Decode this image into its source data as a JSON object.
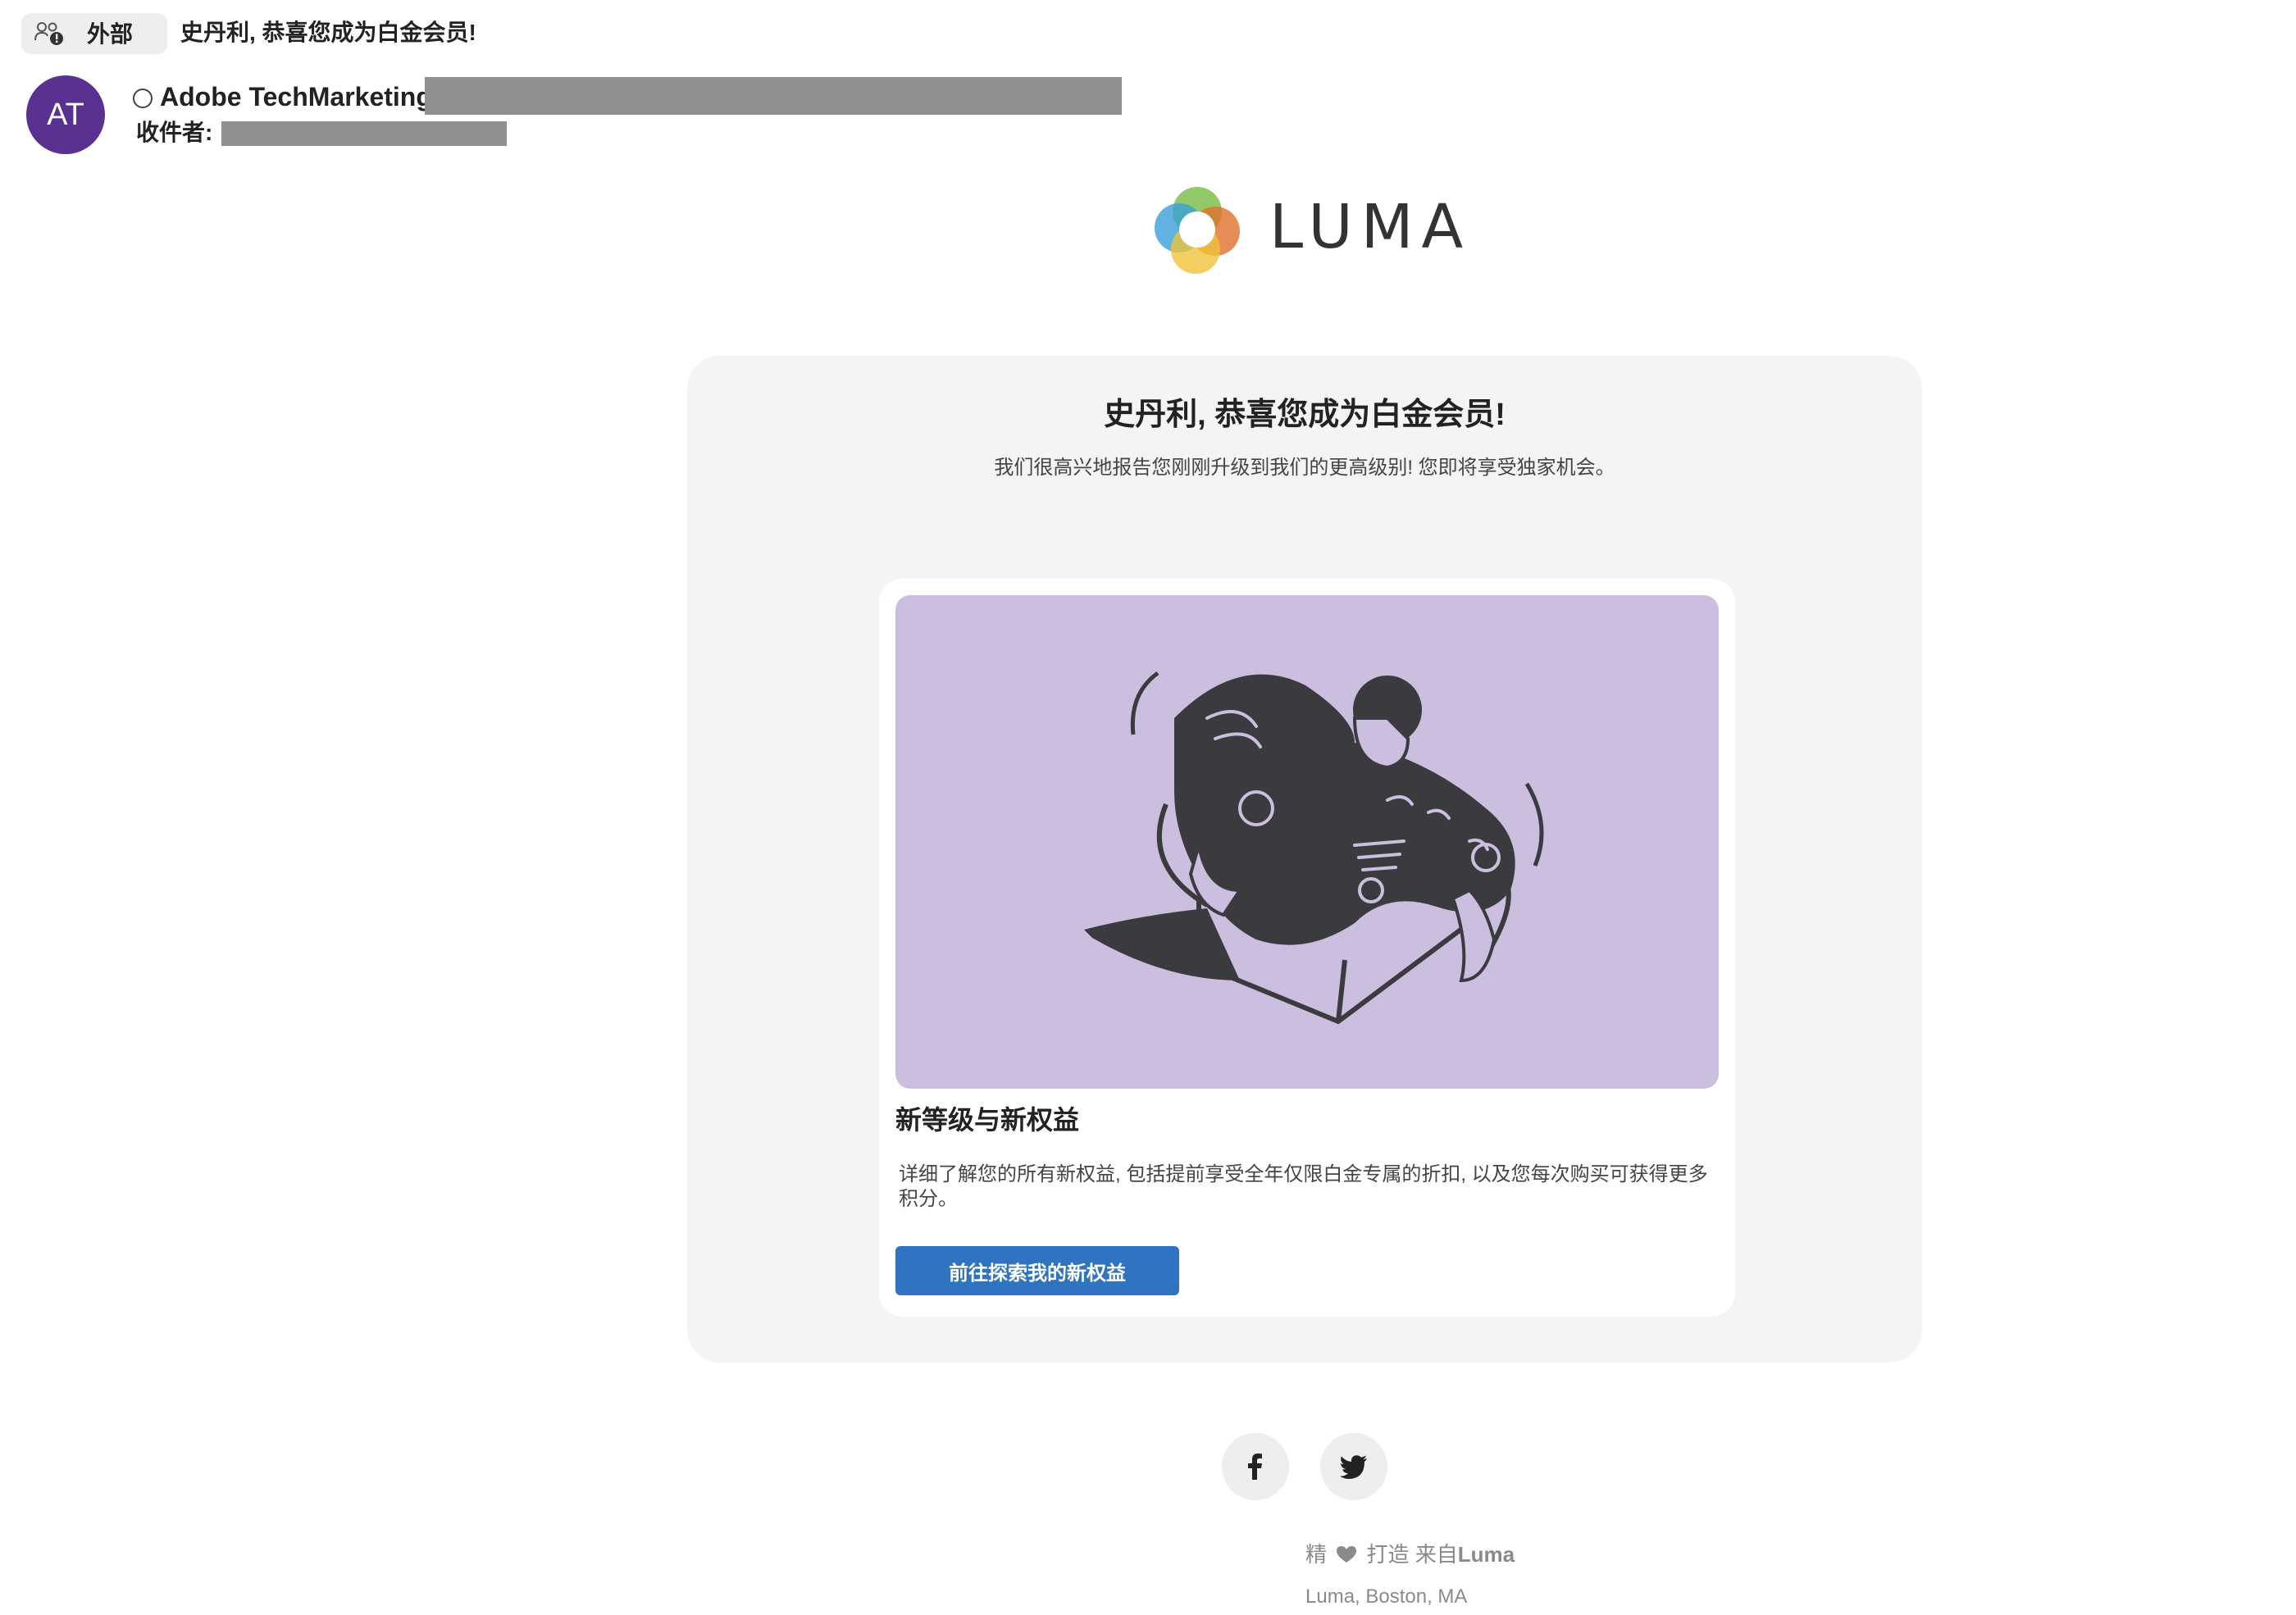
{
  "header": {
    "external_tag": "外部",
    "subject": "史丹利, 恭喜您成为白金会员!",
    "avatar_initials": "AT",
    "sender_name": "Adobe TechMarketing",
    "to_label": "收件者:"
  },
  "brand": {
    "logo_text": "LUMA"
  },
  "email": {
    "headline": "史丹利, 恭喜您成为白金会员!",
    "subheadline": "我们很高兴地报告您刚刚升级到我们的更高级别! 您即将享受独家机会。",
    "benefit_title": "新等级与新权益",
    "benefit_text": "详细了解您的所有新权益, 包括提前享受全年仅限白金专属的折扣, 以及您每次购买可获得更多积分。",
    "cta_label": "前往探索我的新权益"
  },
  "footer": {
    "made_with_prefix": "精",
    "made_with_middle": "打造 来自",
    "made_with_brand": "Luma",
    "address": "Luma, Boston, MA"
  },
  "colors": {
    "avatar": "#5a3190",
    "cta": "#2f74c0",
    "hero_background": "#cbbedf"
  },
  "icons": [
    "external-user-icon",
    "presence-icon",
    "luma-logo-icon",
    "facebook-icon",
    "twitter-icon",
    "heart-icon"
  ]
}
